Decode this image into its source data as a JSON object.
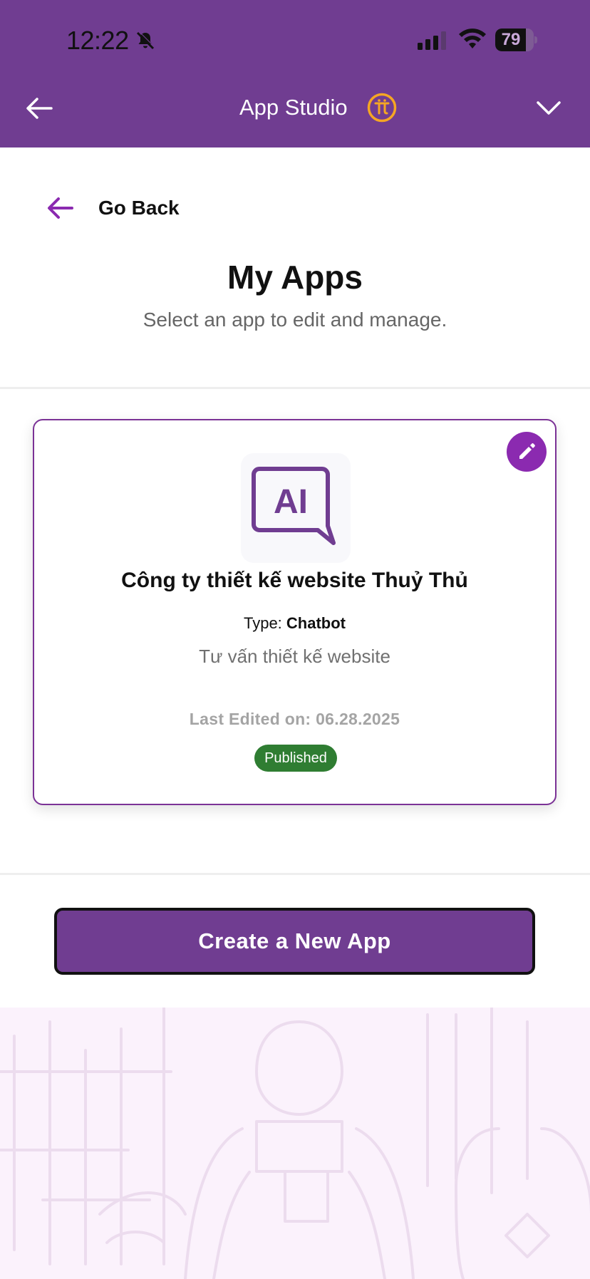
{
  "status_bar": {
    "time": "12:22",
    "battery": "79",
    "battery_level": 0.79
  },
  "header": {
    "title": "App Studio",
    "logo": "pi-logo"
  },
  "nav": {
    "go_back": "Go Back"
  },
  "page": {
    "title": "My Apps",
    "subtitle": "Select an app to edit and manage."
  },
  "apps": [
    {
      "name": "Công ty thiết kế website Thuỷ Thủ",
      "type_label": "Type:",
      "type_value": "Chatbot",
      "description": "Tư vấn thiết kế website",
      "last_edited": "Last Edited on: 06.28.2025",
      "status": "Published",
      "icon_text": "AI"
    }
  ],
  "actions": {
    "create": "Create a New App"
  },
  "colors": {
    "brand": "#703d91",
    "accent": "#8b2ab0",
    "published": "#2f7d32",
    "pi_gold": "#f5a623"
  }
}
